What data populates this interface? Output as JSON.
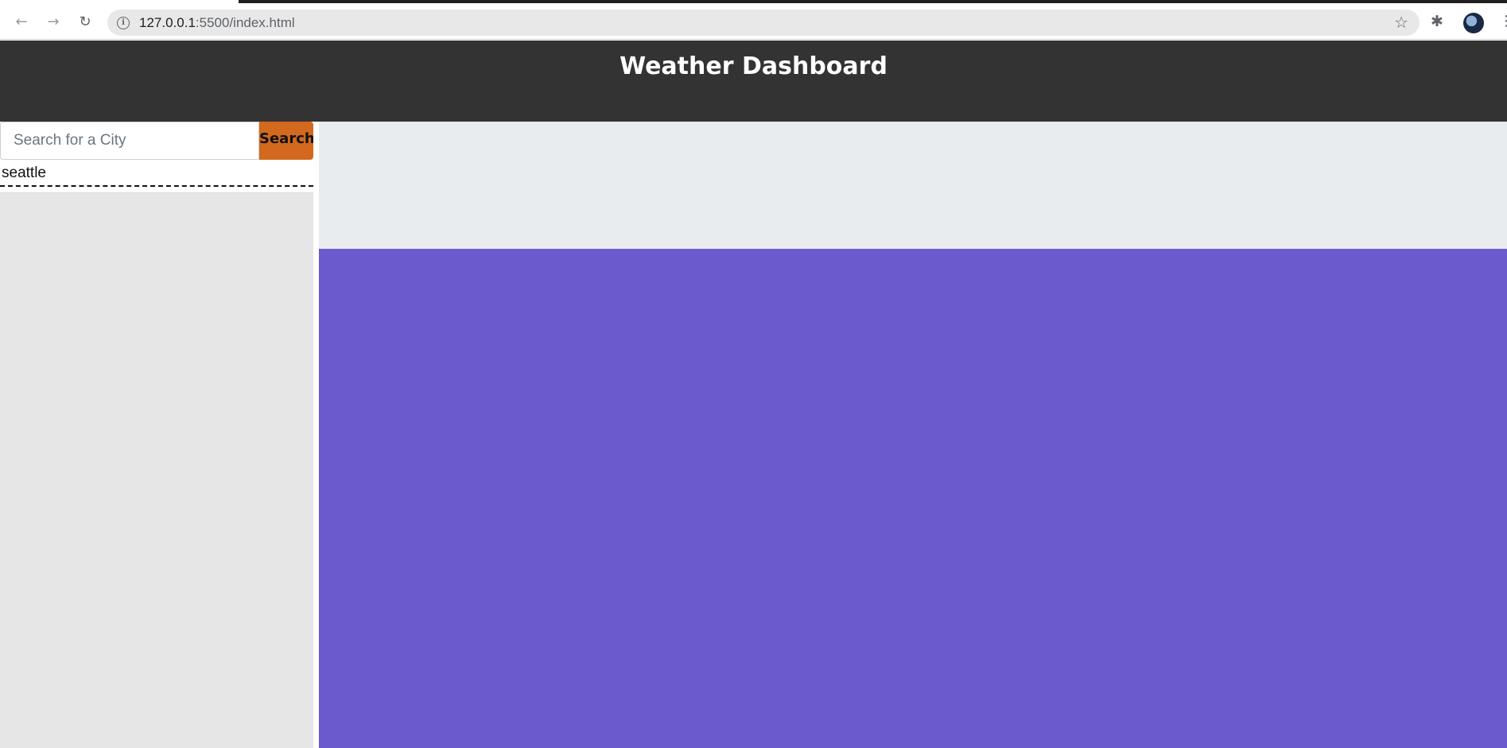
{
  "browser": {
    "url_host": "127.0.0.1",
    "url_rest": ":5500/index.html",
    "icons": {
      "back": "back-arrow-icon",
      "forward": "forward-arrow-icon",
      "reload": "reload-icon",
      "info": "info-icon",
      "star": "star-icon",
      "extensions": "puzzle-icon",
      "menu": "kebab-menu-icon"
    }
  },
  "header": {
    "title": "Weather Dashboard",
    "background": "#333333"
  },
  "search": {
    "placeholder": "Search for a City",
    "value": "",
    "button_label": "Search",
    "button_color": "#d2691e"
  },
  "history": {
    "items": [
      "seattle"
    ]
  },
  "panels": {
    "current_weather_bg": "#e9ecef",
    "forecast_bg": "#6a5acd"
  }
}
